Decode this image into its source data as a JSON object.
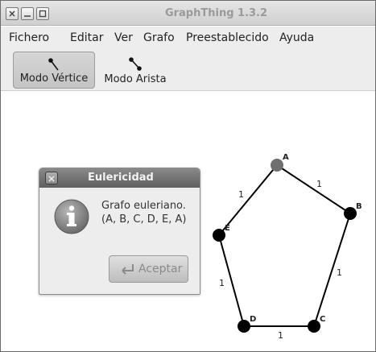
{
  "window": {
    "title": "GraphThing 1.3.2"
  },
  "menu": {
    "items": [
      "Fichero",
      "Editar",
      "Ver",
      "Grafo",
      "Preestablecido",
      "Ayuda"
    ]
  },
  "toolbar": {
    "vertex_mode_label": "Modo Vértice",
    "edge_mode_label": "Modo Arista",
    "active": "vertex"
  },
  "graph": {
    "vertices": [
      {
        "label": "A",
        "color": "#6f6f6f"
      },
      {
        "label": "B",
        "color": "#000000"
      },
      {
        "label": "C",
        "color": "#000000"
      },
      {
        "label": "D",
        "color": "#000000"
      },
      {
        "label": "E",
        "color": "#000000"
      }
    ],
    "edges": [
      {
        "from": "A",
        "to": "B",
        "weight": "1"
      },
      {
        "from": "B",
        "to": "C",
        "weight": "1"
      },
      {
        "from": "C",
        "to": "D",
        "weight": "1"
      },
      {
        "from": "D",
        "to": "E",
        "weight": "1"
      },
      {
        "from": "E",
        "to": "A",
        "weight": "1"
      }
    ]
  },
  "dialog": {
    "title": "Eulericidad",
    "message_line1": "Grafo euleriano.",
    "message_line2": "(A, B, C, D, E, A)",
    "accept_label": "Aceptar"
  },
  "icons": {
    "close": "close-icon",
    "minimize": "minimize-icon",
    "maximize": "maximize-icon",
    "info": "info-icon",
    "accept": "return-arrow-icon"
  }
}
